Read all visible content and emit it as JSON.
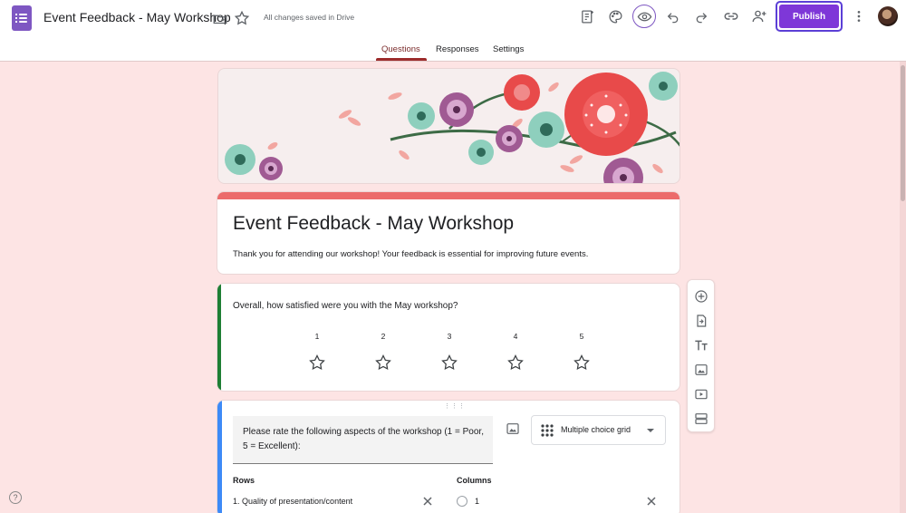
{
  "app": {
    "doc_title": "Event Feedback - May Workshop",
    "save_status": "All changes saved in Drive",
    "publish_label": "Publish"
  },
  "tabs": [
    {
      "label": "Questions",
      "active": true
    },
    {
      "label": "Responses",
      "active": false
    },
    {
      "label": "Settings",
      "active": false
    }
  ],
  "toolbar_icons": [
    "forms-logo-icon",
    "move-to-folder-icon",
    "star-icon",
    "addon-icon",
    "palette-icon",
    "preview-eye-icon",
    "undo-icon",
    "redo-icon",
    "link-icon",
    "add-collaborator-icon",
    "more-vert-icon"
  ],
  "form": {
    "title": "Event Feedback - May Workshop",
    "description": "Thank you for attending our workshop! Your feedback is essential for improving future events.",
    "theme_color": "#ec6b6b"
  },
  "question1": {
    "text": "Overall, how satisfied were you with the May workshop?",
    "scale": [
      "1",
      "2",
      "3",
      "4",
      "5"
    ]
  },
  "question2": {
    "text": "Please rate the following aspects of the workshop (1 = Poor, 5 = Excellent):",
    "type": "Multiple choice grid",
    "rows_label": "Rows",
    "columns_label": "Columns",
    "row1": "1.  Quality of presentation/content",
    "col1": "1"
  },
  "float_toolbar": [
    "add-question-icon",
    "import-questions-icon",
    "add-title-icon",
    "add-image-icon",
    "add-video-icon",
    "add-section-icon"
  ],
  "help_label": "?"
}
